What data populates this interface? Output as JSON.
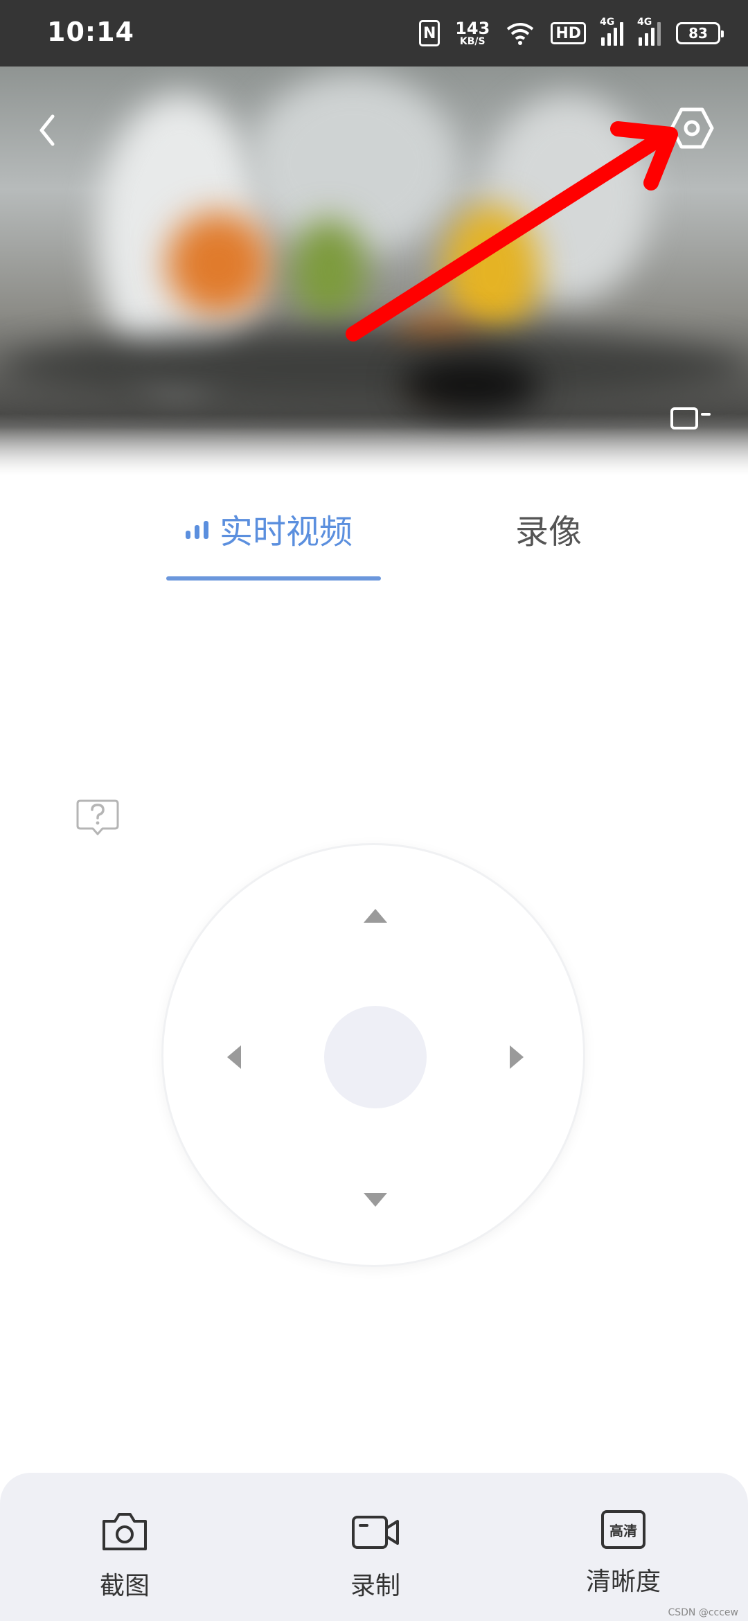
{
  "status_bar": {
    "time": "10:14",
    "nfc_label": "N",
    "net_speed_value": "143",
    "net_speed_unit": "KB/S",
    "hd_label": "HD",
    "signal1_label": "4G",
    "signal2_label": "4G",
    "battery_level": "83"
  },
  "video": {
    "icons": [
      "back-icon",
      "settings-icon",
      "fullscreen-icon"
    ],
    "annotation_arrow_color": "#ff0000"
  },
  "tabs": [
    {
      "label": "实时视频",
      "active": true
    },
    {
      "label": "录像",
      "active": false
    }
  ],
  "ptz": {
    "icons": [
      "up-arrow-icon",
      "down-arrow-icon",
      "left-arrow-icon",
      "right-arrow-icon",
      "center-button"
    ]
  },
  "toolbar": {
    "screenshot_label": "截图",
    "record_label": "录制",
    "quality_label": "清晰度",
    "quality_icon_text": "高清"
  },
  "watermark": "CSDN @cccew",
  "colors": {
    "accent": "#5b8fde",
    "status_bar_bg": "#353535",
    "toolbar_bg": "#eff0f5"
  }
}
